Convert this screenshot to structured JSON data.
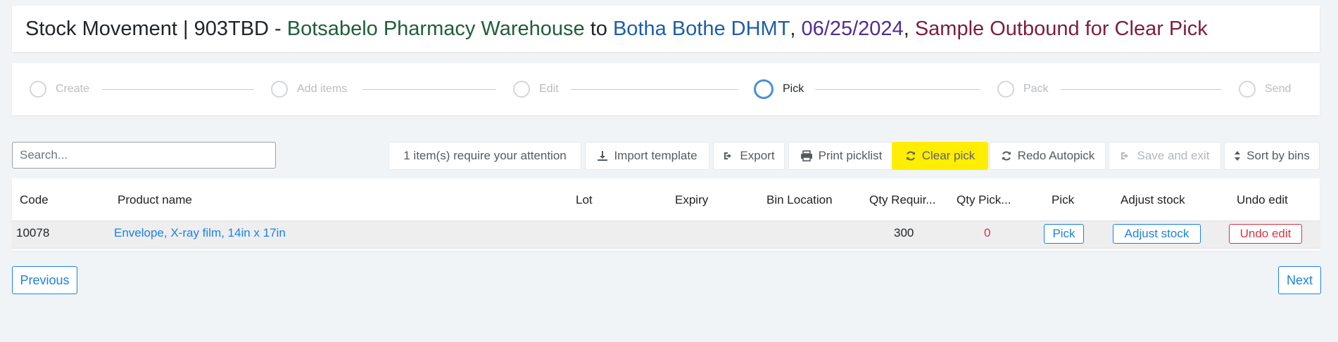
{
  "header": {
    "prefix": "Stock Movement | 903TBD - ",
    "origin": "Botsabelo Pharmacy Warehouse",
    "to": " to ",
    "destination": "Botha Bothe DHMT",
    "sep1": ", ",
    "date": "06/25/2024",
    "sep2": ", ",
    "description": "Sample Outbound for Clear Pick",
    "colors": {
      "origin": "#1f5e3a",
      "destination": "#1d5ea8",
      "date": "#4f2d91",
      "description": "#7b1f3c"
    }
  },
  "wizard": {
    "active_step": "Pick",
    "steps": [
      {
        "label": "Create"
      },
      {
        "label": "Add items"
      },
      {
        "label": "Edit"
      },
      {
        "label": "Pick"
      },
      {
        "label": "Pack"
      },
      {
        "label": "Send"
      }
    ]
  },
  "search": {
    "placeholder": "Search...",
    "value": ""
  },
  "toolbar": {
    "attention": "1 item(s) require your attention",
    "import_template": "Import template",
    "export": "Export",
    "print_picklist": "Print picklist",
    "clear_pick": "Clear pick",
    "redo_autopick": "Redo Autopick",
    "save_and_exit": "Save and exit",
    "sort_by_bins": "Sort by bins",
    "highlight_color": "#ffee00"
  },
  "table": {
    "headers": {
      "code": "Code",
      "product": "Product name",
      "lot": "Lot",
      "expiry": "Expiry",
      "bin": "Bin Location",
      "qty_required": "Qty Requir...",
      "qty_picked": "Qty Pick...",
      "pick": "Pick",
      "adjust": "Adjust stock",
      "undo": "Undo edit"
    },
    "rows": [
      {
        "code": "10078",
        "product": "Envelope, X-ray film, 14in x 17in",
        "lot": "",
        "expiry": "",
        "bin": "",
        "qty_required": "300",
        "qty_picked": "0",
        "pick": "Pick",
        "adjust": "Adjust stock",
        "undo": "Undo edit"
      }
    ]
  },
  "footer": {
    "previous": "Previous",
    "next": "Next"
  }
}
